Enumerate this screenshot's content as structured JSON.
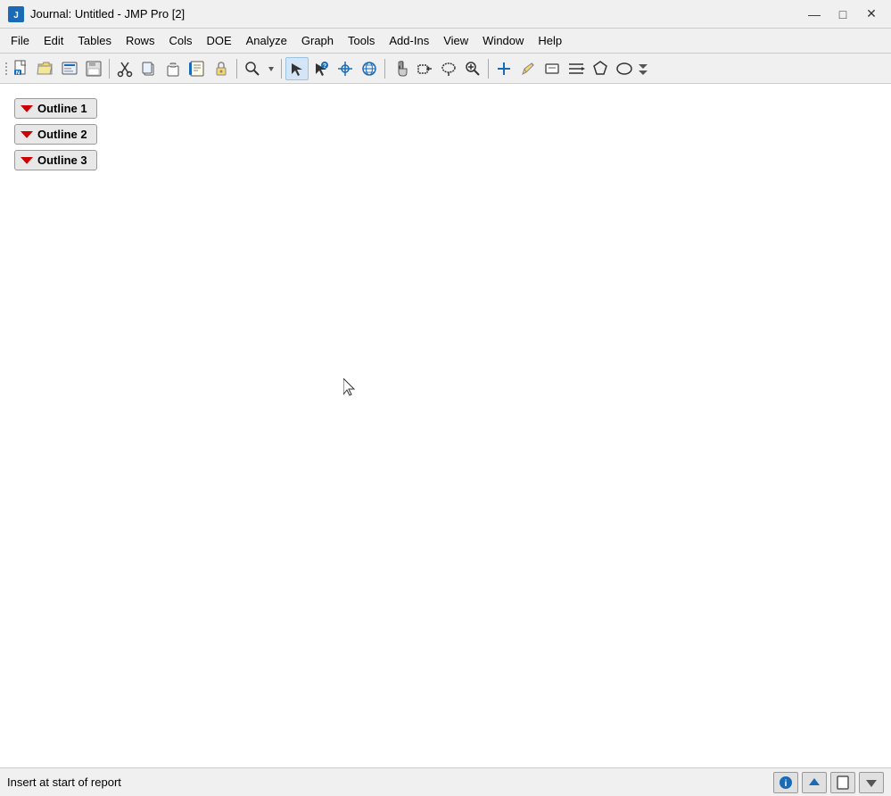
{
  "titlebar": {
    "title": "Journal: Untitled - JMP Pro [2]",
    "icon": "📊",
    "minimize": "—",
    "maximize": "□",
    "close": "✕"
  },
  "menubar": {
    "items": [
      "File",
      "Edit",
      "Tables",
      "Rows",
      "Cols",
      "DOE",
      "Analyze",
      "Graph",
      "Tools",
      "Add-Ins",
      "View",
      "Window",
      "Help"
    ]
  },
  "toolbar": {
    "buttons": [
      {
        "name": "new",
        "icon": "🗋",
        "label": "New"
      },
      {
        "name": "open",
        "icon": "📂",
        "label": "Open"
      },
      {
        "name": "browse",
        "icon": "📁",
        "label": "Browse"
      },
      {
        "name": "save",
        "icon": "💾",
        "label": "Save"
      },
      {
        "name": "cut",
        "icon": "✂",
        "label": "Cut"
      },
      {
        "name": "copy",
        "icon": "📋",
        "label": "Copy"
      },
      {
        "name": "paste",
        "icon": "📌",
        "label": "Paste"
      },
      {
        "name": "journal",
        "icon": "📓",
        "label": "Journal"
      },
      {
        "name": "lock",
        "icon": "🔒",
        "label": "Lock"
      },
      {
        "name": "search",
        "icon": "🔍",
        "label": "Search"
      },
      {
        "name": "arrow",
        "icon": "↖",
        "label": "Arrow"
      },
      {
        "name": "help",
        "icon": "?",
        "label": "Help"
      },
      {
        "name": "cross",
        "icon": "+",
        "label": "Crosshair"
      },
      {
        "name": "globe",
        "icon": "🌐",
        "label": "Globe"
      },
      {
        "name": "hand",
        "icon": "✋",
        "label": "Hand"
      },
      {
        "name": "select",
        "icon": "◻",
        "label": "Select"
      },
      {
        "name": "lasso",
        "icon": "◯",
        "label": "Lasso"
      },
      {
        "name": "zoom",
        "icon": "🔎",
        "label": "Zoom"
      },
      {
        "name": "zoom-in",
        "icon": "+",
        "label": "Zoom In"
      },
      {
        "name": "pencil",
        "icon": "✏",
        "label": "Pencil"
      },
      {
        "name": "annotate",
        "icon": "▭",
        "label": "Annotate"
      },
      {
        "name": "lines",
        "icon": "≡",
        "label": "Lines"
      },
      {
        "name": "polygon",
        "icon": "⬠",
        "label": "Polygon"
      },
      {
        "name": "ellipse",
        "icon": "⬭",
        "label": "Ellipse"
      }
    ]
  },
  "outlines": [
    {
      "id": 1,
      "label": "Outline 1"
    },
    {
      "id": 2,
      "label": "Outline 2"
    },
    {
      "id": 3,
      "label": "Outline 3"
    }
  ],
  "statusbar": {
    "text": "Insert at start of report",
    "info_icon": "ℹ",
    "up_icon": "▲",
    "page_icon": "□",
    "down_icon": "▼"
  }
}
